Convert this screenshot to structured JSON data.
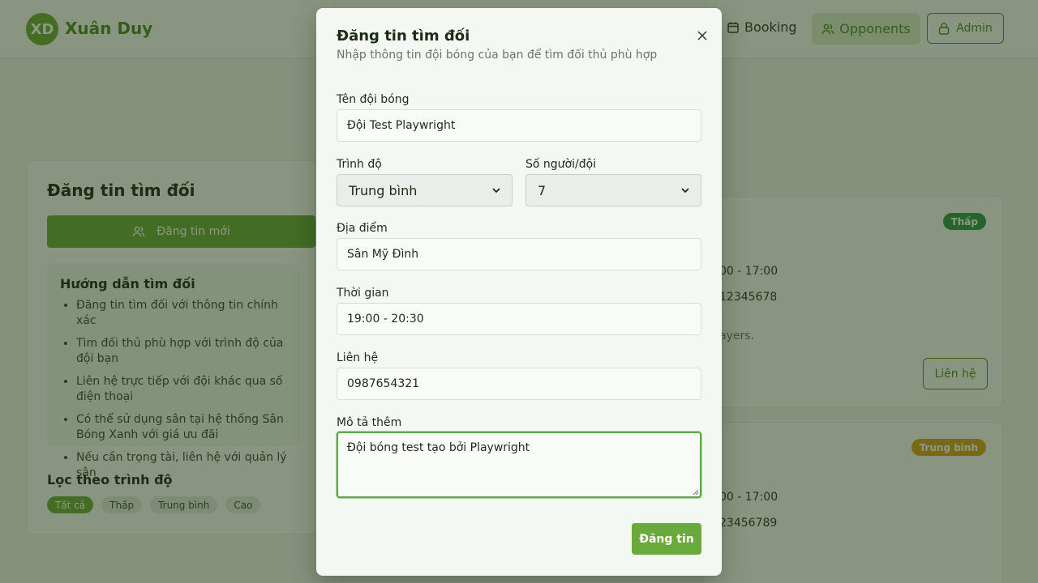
{
  "header": {
    "logo_initials": "XD",
    "brand": "Xuân Duy",
    "nav_booking": "Booking",
    "nav_opponents": "Opponents",
    "nav_admin": "Admin"
  },
  "sidebar": {
    "title": "Đăng tin tìm đối",
    "new_post_label": "Đăng tin mới",
    "guide_title": "Hướng dẫn tìm đối",
    "guide_items": [
      "Đăng tin tìm đối với thông tin chính xác",
      "Tìm đối thủ phù hợp với trình độ của đội bạn",
      "Liên hệ trực tiếp với đội khác qua số điện thoại",
      "Có thể sử dụng sân tại hệ thống Sân Bóng Xanh với giá ưu đãi",
      "Nếu cần trọng tài, liên hệ với quản lý sân"
    ],
    "filter_title": "Lọc theo trình độ",
    "filters": [
      "Tất cả",
      "Thấp",
      "Trung bình",
      "Cao"
    ]
  },
  "posts": [
    {
      "badge": "Thấp",
      "badge_color": "#2f9a4c",
      "time_partial": "00 - 17:00",
      "phone_partial": "12345678",
      "note_partial": "ayers.",
      "contact_label": "Liên hệ"
    },
    {
      "badge": "Trung bình",
      "badge_color": "#d6a21a",
      "time_partial": "00 - 17:00",
      "phone_partial": "23456789"
    }
  ],
  "modal": {
    "title": "Đăng tin tìm đối",
    "subtitle": "Nhập thông tin đội bóng của bạn để tìm đối thủ phù hợp",
    "team_name_label": "Tên đội bóng",
    "team_name_value": "Đội Test Playwright",
    "level_label": "Trình độ",
    "level_value": "Trung bình",
    "players_label": "Số người/đội",
    "players_value": "7",
    "location_label": "Địa điểm",
    "location_value": "Sân Mỹ Đình",
    "time_label": "Thời gian",
    "time_value": "19:00 - 20:30",
    "contact_label": "Liên hệ",
    "contact_value": "0987654321",
    "description_label": "Mô tả thêm",
    "description_value": "Đội bóng test tạo bởi Playwright",
    "submit_label": "Đăng tin"
  },
  "colors": {
    "accent": "#6aa93c",
    "focus_ring": "#5aa84b"
  }
}
